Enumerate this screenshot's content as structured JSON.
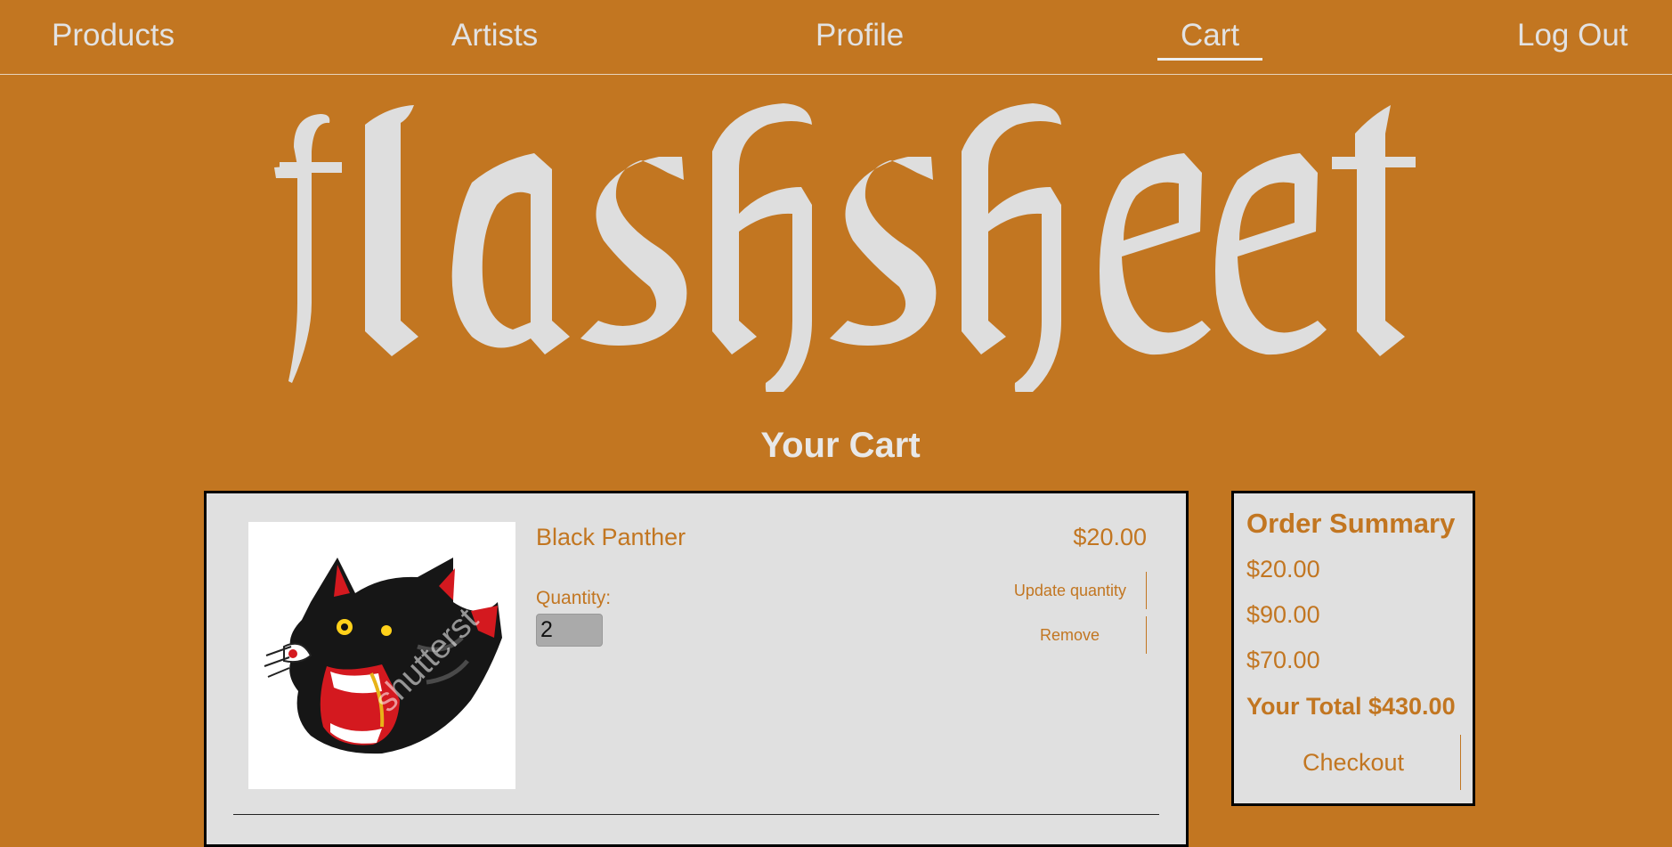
{
  "nav": {
    "items": [
      {
        "label": "Products"
      },
      {
        "label": "Artists"
      },
      {
        "label": "Profile"
      },
      {
        "label": "Cart",
        "active": true
      },
      {
        "label": "Log Out"
      }
    ]
  },
  "brand": {
    "logo_text": "flashsheet",
    "logo_icon": "blackletter-wordmark"
  },
  "cart": {
    "heading": "Your Cart",
    "items": [
      {
        "name": "Black Panther",
        "price": "$20.00",
        "quantity_label": "Quantity:",
        "quantity": "2",
        "update_label": "Update quantity",
        "remove_label": "Remove",
        "image_icon": "black-panther-tattoo-image"
      }
    ]
  },
  "summary": {
    "title": "Order Summary",
    "lines": [
      "$20.00",
      "$90.00",
      "$70.00"
    ],
    "total": "Your Total $430.00",
    "checkout_label": "Checkout"
  },
  "colors": {
    "background": "#c27621",
    "panel": "#e0e0e0",
    "accent": "#c27621",
    "nav_text": "#e2e2e2"
  }
}
